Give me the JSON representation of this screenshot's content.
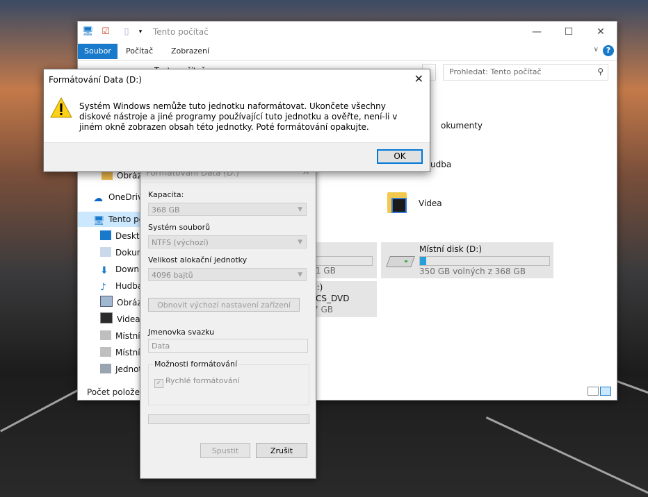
{
  "explorer": {
    "title": "Tento počítač",
    "ribbon_tabs": [
      "Soubor",
      "Počítač",
      "Zobrazení"
    ],
    "help": "?",
    "search_placeholder": "Prohledat: Tento počítač",
    "address_partial": "Tento počítač",
    "nav": [
      {
        "label": "Obrázky",
        "icon": "folder-icon"
      },
      {
        "label": "OneDrive",
        "icon": "onedrive-icon"
      },
      {
        "label": "Tento počítač",
        "icon": "computer-icon"
      },
      {
        "label": "Desktop",
        "icon": "desktop-icon"
      },
      {
        "label": "Dokumenty",
        "icon": "documents-icon"
      },
      {
        "label": "Downloads",
        "icon": "downloads-icon"
      },
      {
        "label": "Hudba",
        "icon": "music-icon"
      },
      {
        "label": "Obrázky",
        "icon": "pictures-icon"
      },
      {
        "label": "Videa",
        "icon": "videos-icon"
      },
      {
        "label": "Místní disk",
        "icon": "drive-icon"
      },
      {
        "label": "Místní disk",
        "icon": "drive-icon"
      },
      {
        "label": "Jednotka",
        "icon": "dvd-icon"
      }
    ],
    "nav_display": [
      "Obrázk",
      "OneDrive",
      "Tento po",
      "Desktop",
      "Dokum",
      "Downlo",
      "Hudba",
      "Obrázk",
      "Videa",
      "Místní",
      "Místní",
      "Jednot"
    ],
    "folders": {
      "dokumenty_partial": "okumenty",
      "hudba_partial": "udba",
      "videa": "Videa"
    },
    "drives": [
      {
        "name": "Místní disk (D:)",
        "free": "350 GB volných z 368 GB",
        "fill": 0.05
      }
    ],
    "drive_c_partial": ",1 GB",
    "dvd_partial_name": "E:)",
    "dvd_partial_label": "_CS_DVD",
    "dvd_partial_size": "7 GB",
    "status": "Počet položek:"
  },
  "format_dialog": {
    "title": "Formátování Data (D:)",
    "capacity_label": "Kapacita:",
    "capacity_value": "368 GB",
    "fs_label": "Systém souborů",
    "fs_value": "NTFS (výchozí)",
    "alloc_label": "Velikost alokační jednotky",
    "alloc_value": "4096 bajtů",
    "restore_button": "Obnovit výchozí nastavení zařízení",
    "volume_label": "Jmenovka svazku",
    "volume_value": "Data",
    "options_label": "Možnosti formátování",
    "quick_format": "Rychlé formátování",
    "start_button": "Spustit",
    "cancel_button": "Zrušit"
  },
  "message_box": {
    "title": "Formátování Data (D:)",
    "text": "Systém Windows nemůže tuto jednotku naformátovat. Ukončete všechny diskové nástroje a jiné programy používající tuto jednotku a ověřte, není-li v jiném okně zobrazen obsah této jednotky. Poté formátování opakujte.",
    "ok": "OK"
  },
  "colors": {
    "accent": "#1979ca",
    "selection": "#cce8ff",
    "drive_bar": "#26a0da",
    "warning": "#fcd116"
  }
}
